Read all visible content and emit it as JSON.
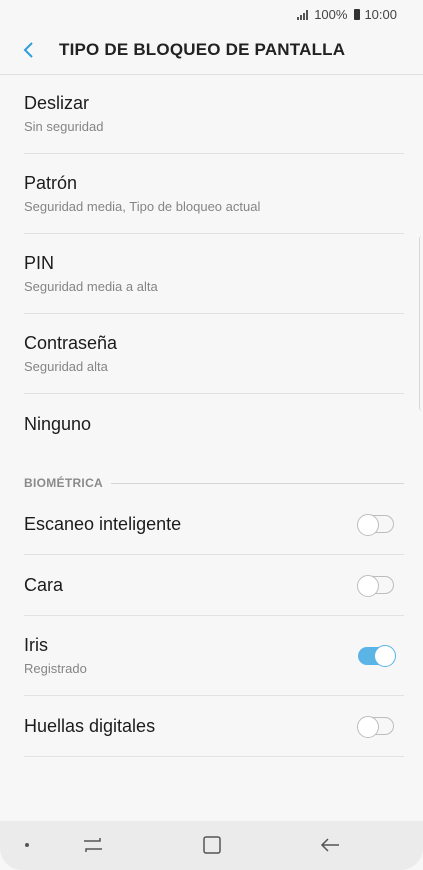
{
  "status_bar": {
    "battery": "100%",
    "time": "10:00"
  },
  "header": {
    "title": "TIPO DE BLOQUEO DE PANTALLA",
    "back_icon": "chevron-left-icon"
  },
  "options": [
    {
      "title": "Deslizar",
      "subtitle": "Sin seguridad"
    },
    {
      "title": "Patrón",
      "subtitle": "Seguridad media, Tipo de bloqueo actual"
    },
    {
      "title": "PIN",
      "subtitle": "Seguridad media a alta"
    },
    {
      "title": "Contraseña",
      "subtitle": "Seguridad alta"
    },
    {
      "title": "Ninguno"
    }
  ],
  "biometrics": {
    "header": "BIOMÉTRICA",
    "items": [
      {
        "title": "Escaneo inteligente",
        "enabled": false
      },
      {
        "title": "Cara",
        "enabled": false
      },
      {
        "title": "Iris",
        "subtitle": "Registrado",
        "enabled": true
      },
      {
        "title": "Huellas digitales",
        "enabled": false
      }
    ]
  },
  "nav_bar": {
    "icons": [
      "dot-icon",
      "recent-apps-icon",
      "home-icon",
      "back-arrow-icon"
    ]
  },
  "colors": {
    "accent": "#5ab4e5",
    "background": "#f7f7f7",
    "nav_background": "#ebebeb"
  }
}
